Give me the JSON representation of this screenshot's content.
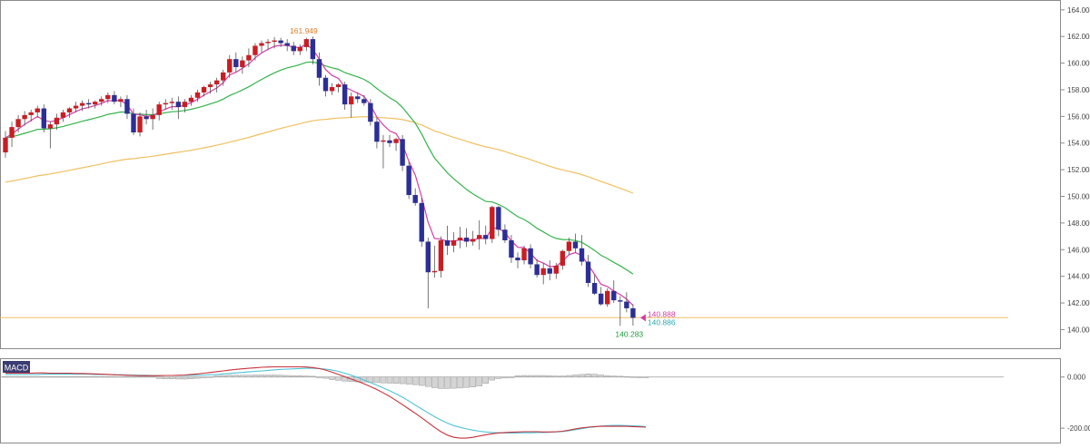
{
  "chart_data": [
    {
      "type": "candlestick",
      "title": "",
      "xlabel": "",
      "ylabel": "",
      "ylim": [
        138.6,
        164.6
      ],
      "yticks": [
        140,
        142,
        144,
        146,
        148,
        150,
        152,
        154,
        156,
        158,
        160,
        162,
        164
      ],
      "ytick_labels": [
        "140.000",
        "142.000",
        "144.000",
        "146.000",
        "148.000",
        "150.000",
        "152.000",
        "154.000",
        "156.000",
        "158.000",
        "160.000",
        "162.000",
        "164.000"
      ],
      "colors": {
        "up": "#c81e23",
        "down": "#2b2f95",
        "ma_short": "#d63ca6",
        "ma_mid": "#33b44a",
        "ma_long": "#f0c060",
        "support": "#f0c060"
      },
      "ohlc": [
        [
          153.3,
          154.9,
          152.9,
          154.4
        ],
        [
          154.4,
          155.6,
          153.7,
          155.2
        ],
        [
          155.2,
          156.1,
          154.8,
          155.8
        ],
        [
          155.8,
          156.4,
          155.3,
          156.1
        ],
        [
          156.1,
          156.5,
          155.6,
          156.3
        ],
        [
          156.3,
          156.8,
          155.9,
          156.6
        ],
        [
          156.6,
          156.9,
          154.8,
          155.1
        ],
        [
          155.1,
          155.6,
          153.6,
          155.4
        ],
        [
          155.4,
          156.2,
          155.0,
          155.9
        ],
        [
          155.9,
          156.5,
          155.6,
          156.3
        ],
        [
          156.3,
          156.7,
          155.9,
          156.6
        ],
        [
          156.6,
          157.1,
          156.3,
          156.8
        ],
        [
          156.8,
          157.2,
          156.4,
          157.0
        ],
        [
          157.0,
          157.3,
          156.6,
          156.9
        ],
        [
          156.9,
          157.2,
          156.6,
          157.1
        ],
        [
          157.1,
          157.5,
          156.8,
          157.3
        ],
        [
          157.3,
          157.8,
          157.0,
          157.6
        ],
        [
          157.6,
          157.9,
          156.9,
          157.1
        ],
        [
          157.1,
          157.5,
          156.7,
          157.3
        ],
        [
          157.3,
          157.6,
          155.8,
          156.2
        ],
        [
          156.2,
          156.6,
          154.6,
          154.8
        ],
        [
          154.8,
          156.3,
          154.5,
          156.0
        ],
        [
          156.0,
          156.5,
          155.4,
          155.8
        ],
        [
          155.8,
          156.6,
          155.0,
          156.1
        ],
        [
          156.1,
          157.1,
          155.7,
          156.9
        ],
        [
          156.9,
          157.3,
          156.5,
          157.0
        ],
        [
          157.0,
          157.4,
          156.5,
          157.1
        ],
        [
          157.1,
          157.5,
          155.8,
          156.7
        ],
        [
          156.7,
          157.3,
          156.3,
          157.1
        ],
        [
          157.1,
          157.6,
          156.8,
          157.4
        ],
        [
          157.4,
          158.0,
          157.1,
          157.8
        ],
        [
          157.8,
          158.3,
          157.5,
          158.2
        ],
        [
          158.2,
          158.6,
          157.7,
          158.4
        ],
        [
          158.4,
          158.9,
          157.8,
          158.7
        ],
        [
          158.7,
          159.5,
          158.3,
          159.3
        ],
        [
          159.3,
          160.6,
          158.9,
          160.3
        ],
        [
          160.3,
          160.8,
          159.3,
          159.7
        ],
        [
          159.7,
          160.5,
          159.2,
          160.2
        ],
        [
          160.2,
          161.1,
          159.7,
          160.6
        ],
        [
          160.6,
          161.5,
          160.2,
          161.3
        ],
        [
          161.3,
          161.7,
          160.8,
          161.5
        ],
        [
          161.5,
          161.8,
          161.0,
          161.6
        ],
        [
          161.6,
          161.95,
          161.1,
          161.7
        ],
        [
          161.7,
          161.9,
          161.2,
          161.5
        ],
        [
          161.5,
          161.8,
          160.9,
          161.3
        ],
        [
          161.3,
          161.6,
          160.6,
          160.9
        ],
        [
          160.9,
          161.4,
          160.6,
          161.2
        ],
        [
          161.2,
          161.9,
          160.9,
          161.8
        ],
        [
          161.8,
          162.0,
          159.9,
          160.3
        ],
        [
          160.3,
          160.8,
          158.3,
          158.9
        ],
        [
          158.9,
          159.1,
          157.5,
          157.9
        ],
        [
          157.9,
          158.5,
          157.6,
          158.2
        ],
        [
          158.2,
          158.5,
          157.8,
          158.4
        ],
        [
          158.4,
          158.6,
          156.5,
          156.9
        ],
        [
          156.9,
          157.8,
          155.9,
          157.5
        ],
        [
          157.5,
          157.8,
          157.0,
          157.3
        ],
        [
          157.3,
          157.6,
          156.8,
          157.0
        ],
        [
          157.0,
          157.3,
          155.3,
          155.6
        ],
        [
          155.6,
          155.9,
          153.6,
          154.1
        ],
        [
          154.1,
          154.6,
          152.1,
          154.2
        ],
        [
          154.2,
          154.6,
          153.7,
          154.0
        ],
        [
          154.0,
          154.4,
          153.4,
          154.3
        ],
        [
          154.3,
          154.6,
          151.9,
          152.3
        ],
        [
          152.3,
          152.6,
          149.8,
          150.1
        ],
        [
          150.1,
          150.6,
          149.3,
          149.5
        ],
        [
          149.5,
          149.9,
          146.2,
          146.6
        ],
        [
          146.6,
          146.9,
          141.6,
          144.3
        ],
        [
          144.3,
          146.3,
          143.9,
          144.4
        ],
        [
          144.4,
          147.0,
          143.9,
          146.7
        ],
        [
          146.7,
          147.8,
          145.6,
          146.3
        ],
        [
          146.3,
          147.3,
          145.8,
          146.7
        ],
        [
          146.7,
          147.7,
          146.1,
          146.9
        ],
        [
          146.9,
          147.6,
          146.2,
          146.6
        ],
        [
          146.6,
          147.4,
          146.3,
          146.8
        ],
        [
          146.8,
          148.2,
          146.0,
          147.1
        ],
        [
          147.1,
          147.8,
          146.4,
          146.8
        ],
        [
          146.8,
          149.3,
          146.5,
          149.2
        ],
        [
          149.2,
          149.3,
          147.0,
          147.5
        ],
        [
          147.5,
          147.9,
          146.5,
          146.7
        ],
        [
          146.7,
          147.1,
          145.0,
          145.4
        ],
        [
          145.4,
          145.8,
          144.6,
          145.2
        ],
        [
          145.2,
          146.3,
          144.9,
          146.1
        ],
        [
          146.1,
          146.4,
          144.6,
          144.9
        ],
        [
          144.9,
          145.3,
          143.9,
          144.1
        ],
        [
          144.1,
          145.0,
          143.4,
          144.6
        ],
        [
          144.6,
          145.2,
          143.7,
          144.2
        ],
        [
          144.2,
          145.0,
          143.8,
          144.8
        ],
        [
          144.8,
          146.0,
          144.5,
          145.9
        ],
        [
          145.9,
          146.9,
          145.6,
          146.6
        ],
        [
          146.6,
          147.2,
          145.8,
          146.1
        ],
        [
          146.1,
          147.1,
          144.8,
          145.1
        ],
        [
          145.1,
          145.6,
          143.2,
          143.5
        ],
        [
          143.5,
          144.1,
          142.6,
          142.7
        ],
        [
          142.7,
          143.2,
          141.8,
          141.9
        ],
        [
          141.9,
          143.1,
          141.7,
          142.9
        ],
        [
          142.9,
          143.7,
          142.0,
          142.2
        ],
        [
          142.2,
          142.5,
          140.283,
          142.1
        ],
        [
          142.1,
          142.8,
          141.3,
          141.6
        ],
        [
          141.6,
          141.9,
          140.3,
          140.886
        ]
      ],
      "annotations": [
        {
          "text": "161.949",
          "value": 161.949,
          "color": "#e07b22"
        },
        {
          "text": "140.283",
          "value": 140.283,
          "color": "#1e9a3c"
        }
      ],
      "last_price_labels": [
        {
          "text": "140.888",
          "color": "#d63ca6"
        },
        {
          "text": "140.886",
          "color": "#2aa9b0"
        }
      ],
      "support_line": 140.9,
      "grid": false
    },
    {
      "type": "line",
      "title": "MACD",
      "xlabel": "",
      "ylabel": "",
      "ylim": [
        -260,
        70
      ],
      "yticks": [
        0,
        -200
      ],
      "ytick_labels": [
        "0.000",
        "-200.000"
      ],
      "colors": {
        "macd": "#c8323a",
        "signal": "#4fc3d6",
        "histogram_fill": "#d4d4d4",
        "histogram_stroke": "#9a9a9a",
        "zero": "#9a9a9a"
      },
      "series": [
        {
          "name": "",
          "values": [
            15,
            15,
            15,
            15,
            15,
            16,
            16,
            15,
            15,
            15,
            15,
            14,
            14,
            13,
            12,
            11,
            10,
            9,
            8,
            7,
            6,
            5,
            5,
            5,
            5,
            6,
            6,
            7,
            8,
            10,
            12,
            15,
            18,
            21,
            24,
            27,
            30,
            32,
            34,
            36,
            38,
            39,
            40,
            40,
            40,
            40,
            40,
            39,
            37,
            33,
            27,
            19,
            10,
            1,
            -8,
            -17,
            -27,
            -37,
            -49,
            -62,
            -76,
            -92,
            -108,
            -125,
            -142,
            -160,
            -178,
            -197,
            -214,
            -227,
            -236,
            -239,
            -239,
            -236,
            -231,
            -226,
            -222,
            -219,
            -217,
            -216,
            -215,
            -214,
            -214,
            -214,
            -215,
            -215,
            -214,
            -212,
            -208,
            -203,
            -199,
            -196,
            -194,
            -193,
            -193,
            -193,
            -193,
            -193,
            -194,
            -195,
            -196
          ]
        },
        {
          "name": "",
          "values": [
            10,
            10,
            10,
            10,
            10,
            10,
            11,
            11,
            11,
            11,
            11,
            11,
            11,
            11,
            10,
            10,
            10,
            9,
            9,
            8,
            8,
            7,
            7,
            6,
            6,
            6,
            6,
            6,
            6,
            7,
            7,
            8,
            9,
            10,
            12,
            14,
            16,
            18,
            20,
            22,
            24,
            26,
            28,
            30,
            31,
            32,
            33,
            34,
            34,
            33,
            31,
            27,
            22,
            15,
            7,
            -2,
            -12,
            -22,
            -32,
            -43,
            -54,
            -66,
            -79,
            -94,
            -110,
            -125,
            -140,
            -155,
            -168,
            -180,
            -190,
            -197,
            -203,
            -208,
            -212,
            -215,
            -217,
            -218,
            -219,
            -219,
            -219,
            -218,
            -218,
            -217,
            -217,
            -216,
            -215,
            -213,
            -210,
            -206,
            -202,
            -198,
            -195,
            -192,
            -190,
            -189,
            -189,
            -190,
            -191,
            -192,
            -194
          ]
        },
        {
          "name": "",
          "type": "histogram",
          "values": [
            2,
            2,
            2,
            2,
            2,
            2,
            2,
            2,
            2,
            2,
            2,
            2,
            2,
            2,
            2,
            2,
            2,
            2,
            2,
            2,
            2,
            2,
            2,
            2,
            -6,
            -7,
            -7,
            -8,
            -8,
            -7,
            -5,
            -3,
            1,
            4,
            6,
            7,
            7,
            7,
            7,
            8,
            8,
            8,
            8,
            7,
            6,
            5,
            5,
            4,
            3,
            -2,
            -5,
            -10,
            -13,
            -16,
            -18,
            -19,
            -20,
            -21,
            -22,
            -23,
            -24,
            -25,
            -26,
            -28,
            -30,
            -33,
            -37,
            -42,
            -45,
            -45,
            -44,
            -43,
            -41,
            -39,
            -35,
            -25,
            -12,
            -6,
            -4,
            -3,
            5,
            6,
            6,
            6,
            6,
            5,
            4,
            4,
            6,
            8,
            10,
            12,
            11,
            8,
            5,
            4,
            3,
            2,
            1,
            0,
            -1
          ]
        }
      ]
    }
  ]
}
